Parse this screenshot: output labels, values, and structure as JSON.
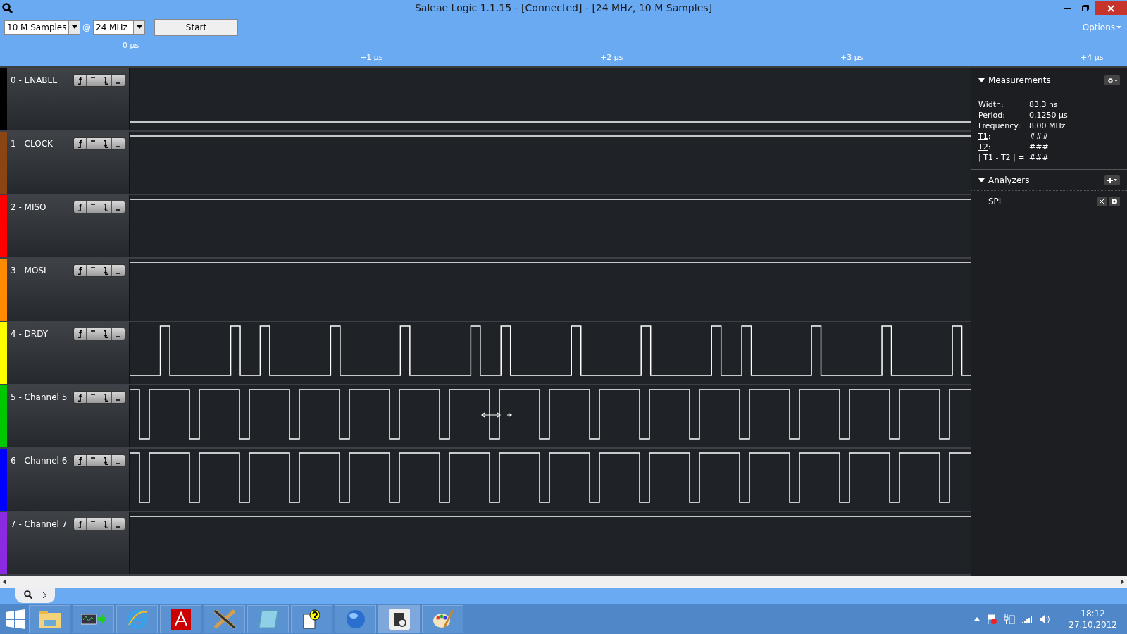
{
  "window": {
    "title": "Saleae Logic 1.1.15 - [Connected] - [24 MHz, 10 M Samples]"
  },
  "toolbar": {
    "samples": "10 M Samples",
    "at": "@",
    "rate": "24 MHz",
    "start": "Start",
    "options": "Options"
  },
  "ruler": [
    "0 µs",
    "+1 µs",
    "+2 µs",
    "+3 µs",
    "+4 µs"
  ],
  "channels": [
    {
      "name": "0 - ENABLE",
      "color": "#000000"
    },
    {
      "name": "1 - CLOCK",
      "color": "#8b4513"
    },
    {
      "name": "2 - MISO",
      "color": "#ff0000"
    },
    {
      "name": "3 - MOSI",
      "color": "#ff8c00"
    },
    {
      "name": "4 - DRDY",
      "color": "#ffff00"
    },
    {
      "name": "5 - Channel 5",
      "color": "#00c800"
    },
    {
      "name": "6 - Channel 6",
      "color": "#0000ff"
    },
    {
      "name": "7 - Channel 7",
      "color": "#8a2be2"
    }
  ],
  "measurements": {
    "title": "Measurements",
    "rows": [
      {
        "label": "Width:",
        "value": "83.3 ns",
        "underline": false
      },
      {
        "label": "Period:",
        "value": "0.1250 µs",
        "underline": false
      },
      {
        "label": "Frequency:",
        "value": "8.00 MHz",
        "underline": false
      },
      {
        "label": "T1",
        "suffix": ":",
        "value": "###",
        "underline": true
      },
      {
        "label": "T2",
        "suffix": ":",
        "value": "###",
        "underline": true
      },
      {
        "label": "| T1 - T2 | =",
        "value": "###",
        "underline": false
      }
    ]
  },
  "analyzers": {
    "title": "Analyzers",
    "items": [
      "SPI"
    ]
  },
  "taskbar": {
    "time": "18:12",
    "date": "27.10.2012"
  }
}
